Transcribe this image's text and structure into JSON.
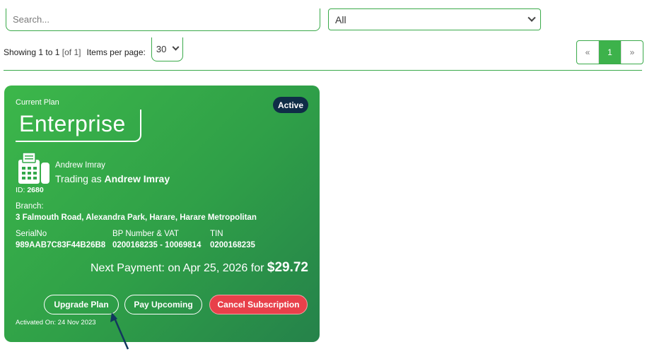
{
  "search": {
    "placeholder": "Search..."
  },
  "filter": {
    "selected": "All"
  },
  "pagination_summary": {
    "showing_prefix": "Showing",
    "from": "1",
    "to_word": "to",
    "to": "1",
    "of_text": "[of 1]",
    "items_per_page_label": "Items per page:",
    "items_per_page_value": "30"
  },
  "pager": {
    "prev": "«",
    "current": "1",
    "next": "»"
  },
  "card": {
    "current_plan_label": "Current Plan",
    "plan_name": "Enterprise",
    "status": "Active",
    "customer_name": "Andrew Imray",
    "trading_prefix": "Trading as",
    "trading_name": "Andrew Imray",
    "id_label": "ID:",
    "id_value": "2680",
    "branch_label": "Branch:",
    "branch_value": "3 Falmouth Road, Alexandra Park, Harare, Harare Metropolitan",
    "serial_label": "SerialNo",
    "serial_value": "989AAB7C83F44B26B8",
    "bp_label": "BP Number & VAT",
    "bp_value": "0200168235 - 10069814",
    "tin_label": "TIN",
    "tin_value": "0200168235",
    "next_payment_text": "Next Payment: on Apr 25, 2026 for",
    "next_payment_amount": "$29.72",
    "upgrade_button": "Upgrade Plan",
    "pay_button": "Pay Upcoming",
    "cancel_button": "Cancel Subscription",
    "activated_text": "Activated On: 24 Nov 2023"
  },
  "colors": {
    "accent_green": "#3aaa4a",
    "card_gradient_start": "#3cb74a",
    "card_gradient_end": "#25824a",
    "badge_navy": "#0f2d47",
    "cancel_red": "#e8404a",
    "cursor_navy": "#12385e"
  },
  "icons": {
    "device_icon": "fax-machine-icon",
    "cursor": "mouse-pointer-arrow"
  }
}
